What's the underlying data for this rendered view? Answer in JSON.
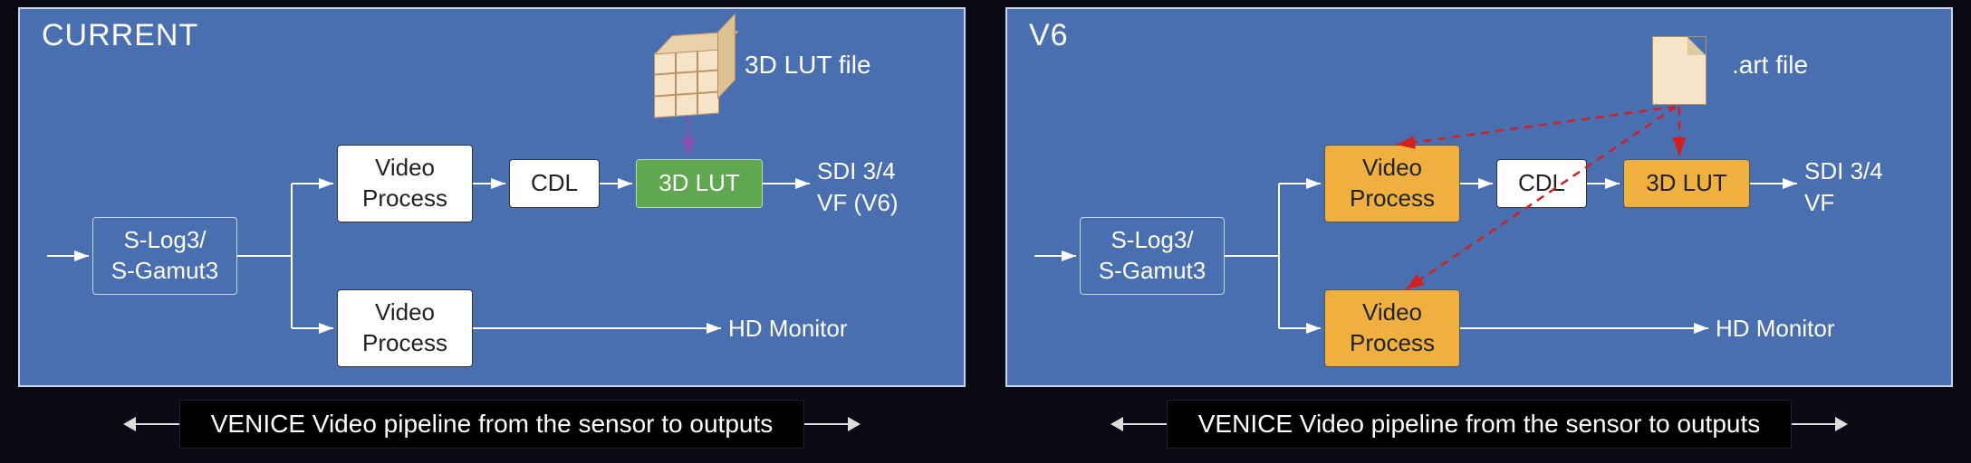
{
  "left": {
    "title": "CURRENT",
    "file_label": "3D LUT file",
    "nodes": {
      "slog": "S-Log3/\nS-Gamut3",
      "vp_top": "Video\nProcess",
      "vp_bottom": "Video\nProcess",
      "cdl": "CDL",
      "lut": "3D LUT"
    },
    "outputs": {
      "top": "SDI 3/4\nVF (V6)",
      "bottom": "HD Monitor"
    },
    "caption": "VENICE Video pipeline from the sensor to outputs"
  },
  "right": {
    "title": "V6",
    "file_label": ".art file",
    "nodes": {
      "slog": "S-Log3/\nS-Gamut3",
      "vp_top": "Video\nProcess",
      "vp_bottom": "Video\nProcess",
      "cdl": "CDL",
      "lut": "3D LUT"
    },
    "outputs": {
      "top": "SDI 3/4\nVF",
      "bottom": "HD Monitor"
    },
    "caption": "VENICE Video pipeline from the sensor to outputs"
  }
}
